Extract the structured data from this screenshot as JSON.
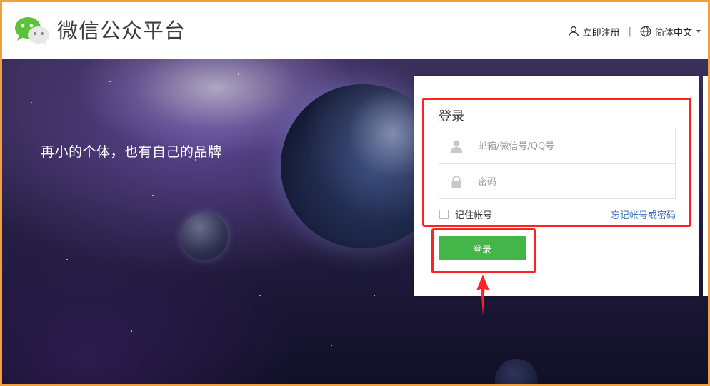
{
  "header": {
    "brand_name": "微信公众平台",
    "logo_icon": "wechat-logo-icon",
    "register_label": "立即注册",
    "register_icon": "user-icon",
    "separator": "|",
    "language_label": "简体中文",
    "language_icon": "globe-icon"
  },
  "banner": {
    "slogan": "再小的个体，也有自己的品牌"
  },
  "login": {
    "title": "登录",
    "account_placeholder": "邮箱/微信号/QQ号",
    "account_value": "",
    "password_placeholder": "密码",
    "password_value": "",
    "remember_label": "记住帐号",
    "remember_checked": false,
    "forgot_label": "忘记帐号或密码",
    "submit_label": "登录"
  },
  "colors": {
    "accent_green": "#44b549",
    "link_blue": "#3a73b5",
    "highlight_red": "#ff2222",
    "frame_orange": "#f0a040"
  }
}
